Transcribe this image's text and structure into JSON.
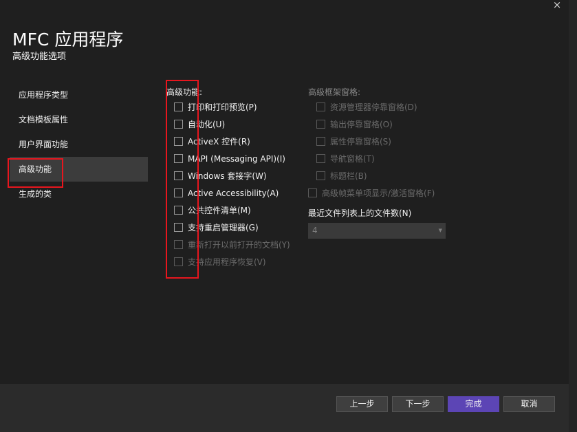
{
  "window": {
    "close_icon": "×",
    "title": "MFC 应用程序",
    "subtitle": "高级功能选项"
  },
  "nav": {
    "items": [
      {
        "label": "应用程序类型",
        "selected": false
      },
      {
        "label": "文档模板属性",
        "selected": false
      },
      {
        "label": "用户界面功能",
        "selected": false
      },
      {
        "label": "高级功能",
        "selected": true
      },
      {
        "label": "生成的类",
        "selected": false
      }
    ]
  },
  "advanced_features": {
    "label": "高级功能:",
    "options": [
      {
        "label": "打印和打印预览(P)",
        "checked": false,
        "enabled": true
      },
      {
        "label": "自动化(U)",
        "checked": false,
        "enabled": true
      },
      {
        "label": "ActiveX 控件(R)",
        "checked": false,
        "enabled": true
      },
      {
        "label": "MAPI (Messaging API)(I)",
        "checked": false,
        "enabled": true
      },
      {
        "label": "Windows 套接字(W)",
        "checked": false,
        "enabled": true
      },
      {
        "label": "Active Accessibility(A)",
        "checked": false,
        "enabled": true
      },
      {
        "label": "公共控件清单(M)",
        "checked": false,
        "enabled": true
      },
      {
        "label": "支持重启管理器(G)",
        "checked": false,
        "enabled": true
      },
      {
        "label": "重新打开以前打开的文档(Y)",
        "checked": false,
        "enabled": false
      },
      {
        "label": "支持应用程序恢复(V)",
        "checked": false,
        "enabled": false
      }
    ]
  },
  "advanced_frame_panes": {
    "label": "高级框架窗格:",
    "options": [
      {
        "label": "资源管理器停靠窗格(D)",
        "checked": false,
        "enabled": false
      },
      {
        "label": "输出停靠窗格(O)",
        "checked": false,
        "enabled": false
      },
      {
        "label": "属性停靠窗格(S)",
        "checked": false,
        "enabled": false
      },
      {
        "label": "导航窗格(T)",
        "checked": false,
        "enabled": false
      },
      {
        "label": "标题栏(B)",
        "checked": false,
        "enabled": false
      }
    ],
    "ribbon_menu_option": {
      "label": "高级帧菜单项显示/激活窗格(F)",
      "checked": false,
      "enabled": false
    }
  },
  "mru_files": {
    "label": "最近文件列表上的文件数(N)",
    "value": "4"
  },
  "footer": {
    "back_label": "上一步",
    "next_label": "下一步",
    "finish_label": "完成",
    "cancel_label": "取消"
  },
  "icons": {
    "close": "close-icon",
    "dropdown": "chevron-down-icon",
    "checkbox": "checkbox-icon"
  },
  "colors": {
    "background": "#1f1f1f",
    "nav_selected": "#3c3c3c",
    "footer": "#2b2b2b",
    "primary_button": "#5c45b5",
    "highlight": "#e8161e"
  }
}
